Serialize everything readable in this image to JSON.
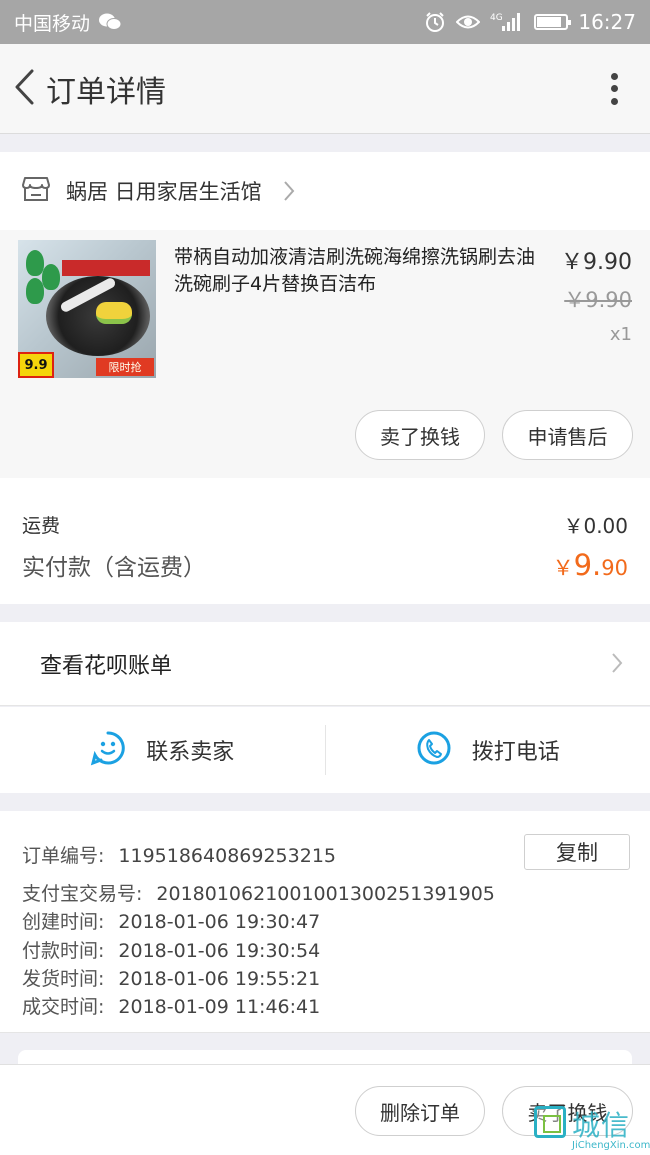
{
  "status_bar": {
    "carrier": "中国移动",
    "network": "4G",
    "time": "16:27",
    "battery_level": 0.85
  },
  "header": {
    "title": "订单详情",
    "back_icon": "chevron-left-icon",
    "more_icon": "vertical-dots-icon"
  },
  "shop": {
    "name": "蜗居 日用家居生活馆",
    "icon": "store-icon"
  },
  "item": {
    "title": "带柄自动加液清洁刷洗碗海绵擦洗锅刷去油洗碗刷子4片替换百洁布",
    "price": "￥9.90",
    "original_price": "￥9.90",
    "quantity": "x1",
    "thumb_badge": "9.9",
    "thumb_tag": "限时抢",
    "actions": {
      "sell": "卖了换钱",
      "after_sale": "申请售后"
    }
  },
  "fees": {
    "shipping_label": "运费",
    "shipping_value": "￥0.00",
    "paid_label": "实付款（含运费）",
    "paid_currency": "￥",
    "paid_int": "9.",
    "paid_dec": "90",
    "accent_color": "#f26a1b"
  },
  "huabei": {
    "label": "查看花呗账单"
  },
  "contact": {
    "seller": "联系卖家",
    "call": "拨打电话",
    "accent_color": "#1ba1e2"
  },
  "order_info": {
    "copy_label": "复制",
    "rows": [
      {
        "key": "订单编号:",
        "value": "119518640869253215"
      },
      {
        "key": "支付宝交易号:",
        "value": "2018010621001001300251391905"
      },
      {
        "key": "创建时间:",
        "value": "2018-01-06 19:30:47"
      },
      {
        "key": "付款时间:",
        "value": "2018-01-06 19:30:54"
      },
      {
        "key": "发货时间:",
        "value": "2018-01-06 19:55:21"
      },
      {
        "key": "成交时间:",
        "value": "2018-01-09 11:46:41"
      }
    ]
  },
  "footer": {
    "delete": "删除订单",
    "sell": "卖了换钱"
  },
  "watermark": {
    "text": "城信",
    "sub": "JiChengXin.com"
  }
}
